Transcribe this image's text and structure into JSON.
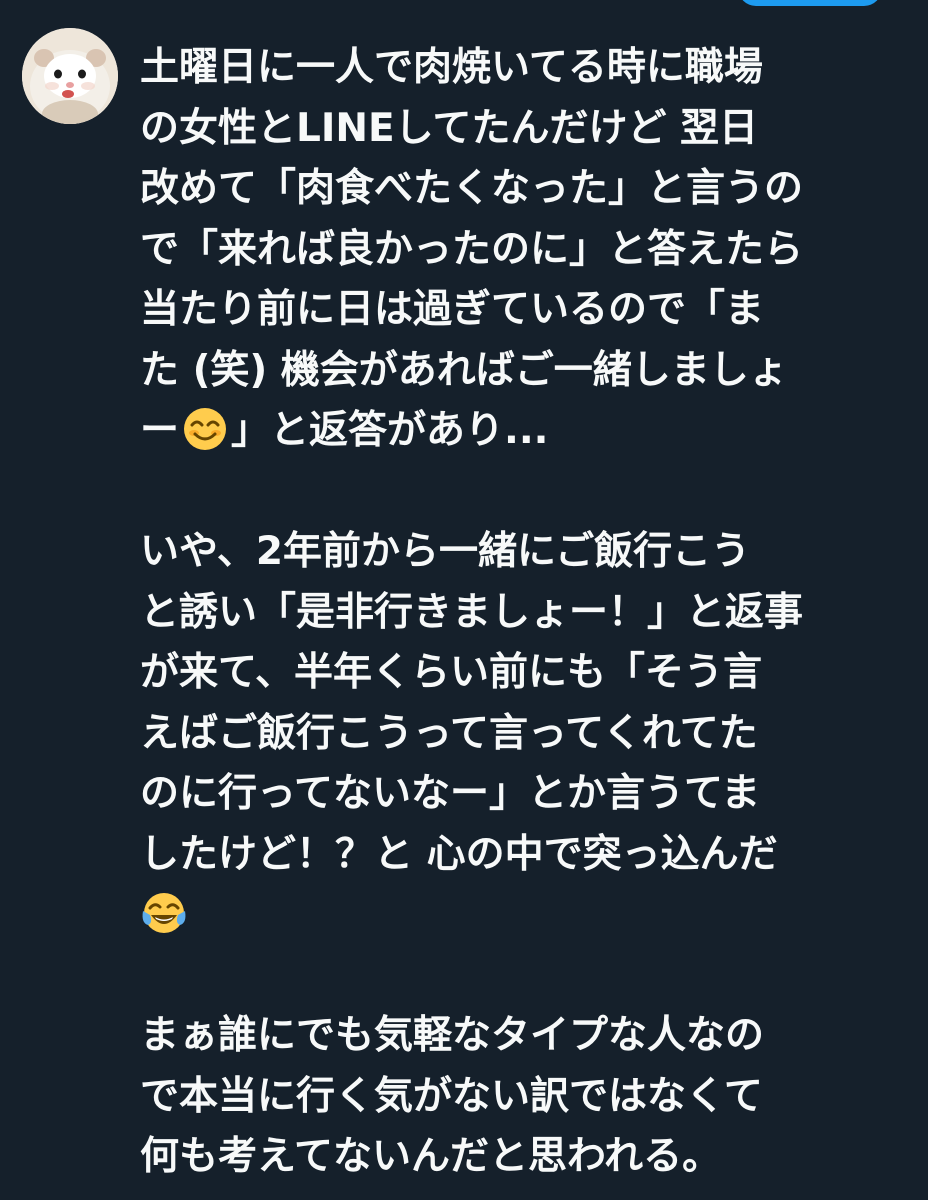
{
  "tweet": {
    "paragraphs": [
      {
        "lines": [
          "土曜日に一人で肉焼いてる時に職場",
          "の女性とLINEしてたんだけど 翌日",
          "改めて「肉食べたくなった」と言うの",
          "で「来れば良かったのに」と答えたら",
          "当たり前に日は過ぎているので「ま",
          "た (笑) 機会があればご一緒しましょ"
        ],
        "emoji_line": {
          "before": "ー",
          "emoji": "smiling-face-emoji",
          "after": "」と返答があり..."
        }
      },
      {
        "lines": [
          "いや、2年前から一緒にご飯行こう",
          "と誘い「是非行きましょー！」と返事",
          "が来て、半年くらい前にも「そう言",
          "えばご飯行こうって言ってくれてた",
          "のに行ってないなー」とか言うてま",
          "したけど！？と 心の中で突っ込んだ"
        ],
        "trailing_emoji": "tears-of-joy-emoji"
      },
      {
        "lines": [
          "まぁ誰にでも気軽なタイプな人なの",
          "で本当に行く気がない訳ではなくて",
          "何も考えてないんだと思われる。"
        ]
      }
    ]
  },
  "colors": {
    "background": "#15202b",
    "text": "#f7f9f9",
    "accent": "#1d9bf0"
  },
  "avatar": {
    "icon": "hamster-avatar"
  }
}
